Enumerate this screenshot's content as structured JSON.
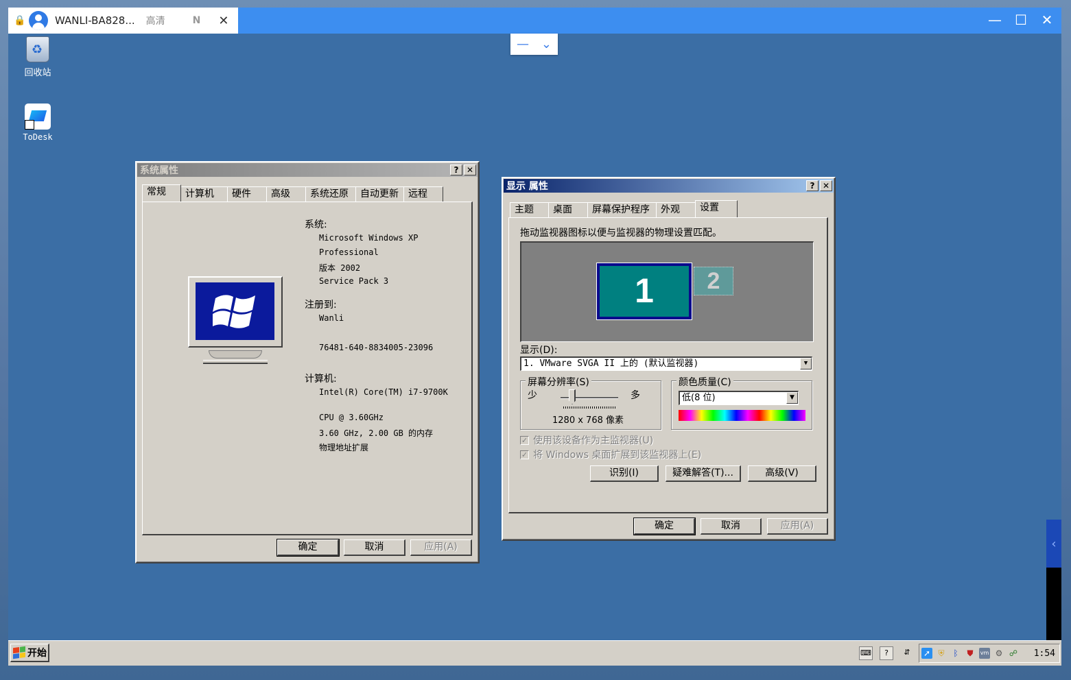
{
  "client": {
    "tab_title": "WANLI-BA828...",
    "quality": "高清",
    "n_badge": "N",
    "close": "✕",
    "controls": {
      "minimize": "—",
      "maximize": "☐",
      "close": "✕"
    },
    "toolbar": {
      "minus": "—",
      "chevron": "⌄"
    },
    "side_arrow": "‹"
  },
  "desktop": {
    "icons": [
      {
        "label": "回收站"
      },
      {
        "label": "ToDesk"
      }
    ]
  },
  "system_properties": {
    "title": "系统属性",
    "help": "?",
    "close": "✕",
    "tabs": [
      "常规",
      "计算机名",
      "硬件",
      "高级",
      "系统还原",
      "自动更新",
      "远程"
    ],
    "system_label": "系统:",
    "system_lines": [
      "Microsoft Windows XP",
      "Professional",
      "版本 2002",
      "Service Pack 3"
    ],
    "registered_label": "注册到:",
    "registered_user": "Wanli",
    "product_id": "76481-640-8834005-23096",
    "computer_label": "计算机:",
    "computer_lines": [
      "Intel(R) Core(TM) i7-9700K",
      "CPU @ 3.60GHz",
      "3.60 GHz, 2.00 GB 的内存",
      "物理地址扩展"
    ],
    "buttons": {
      "ok": "确定",
      "cancel": "取消",
      "apply": "应用(A)"
    }
  },
  "display_properties": {
    "title": "显示 属性",
    "help": "?",
    "close": "✕",
    "tabs": [
      "主题",
      "桌面",
      "屏幕保护程序",
      "外观",
      "设置"
    ],
    "instruction": "拖动监视器图标以便与监视器的物理设置匹配。",
    "monitor1": "1",
    "monitor2": "2",
    "display_label": "显示(D):",
    "display_value": "1. VMware SVGA II 上的 (默认监视器)",
    "resolution_label": "屏幕分辨率(S)",
    "res_less": "少",
    "res_more": "多",
    "resolution_value": "1280 x 768 像素",
    "color_label": "颜色质量(C)",
    "color_value": "低(8 位)",
    "check_primary": "使用该设备作为主监视器(U)",
    "check_extend": "将 Windows 桌面扩展到该监视器上(E)",
    "btn_identify": "识别(I)",
    "btn_troubleshoot": "疑难解答(T)...",
    "btn_advanced": "高级(V)",
    "buttons": {
      "ok": "确定",
      "cancel": "取消",
      "apply": "应用(A)"
    }
  },
  "taskbar": {
    "start": "开始",
    "clock": "1:54",
    "tray_help": "?"
  }
}
